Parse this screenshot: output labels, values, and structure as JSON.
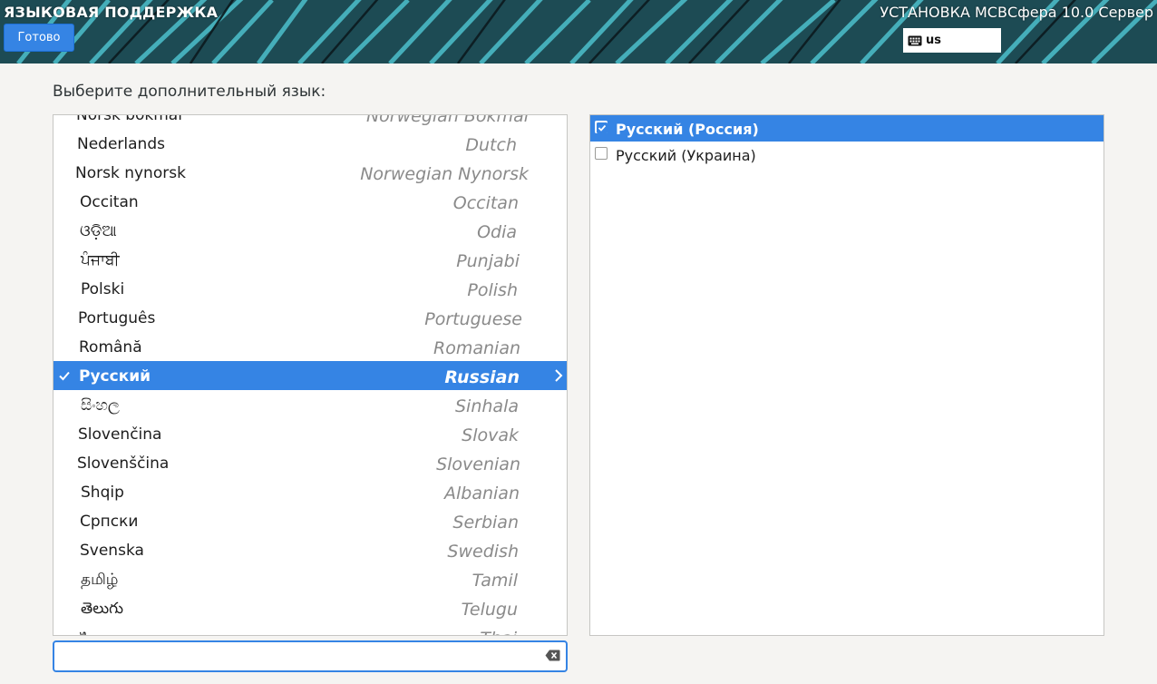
{
  "header": {
    "spoke_title": "ЯЗЫКОВАЯ ПОДДЕРЖКА",
    "done_label": "Готово",
    "product_title": "УСТАНОВКА МСВСфера 10.0 Сервер",
    "keyboard_layout": "us"
  },
  "prompt": "Выберите дополнительный язык:",
  "languages": [
    {
      "native": "Norsk bokmål",
      "english": "Norwegian Bokmål"
    },
    {
      "native": "Nederlands",
      "english": "Dutch"
    },
    {
      "native": "Norsk nynorsk",
      "english": "Norwegian Nynorsk"
    },
    {
      "native": "Occitan",
      "english": "Occitan"
    },
    {
      "native": "ଓଡ଼ିଆ",
      "english": "Odia"
    },
    {
      "native": "ਪੰਜਾਬੀ",
      "english": "Punjabi"
    },
    {
      "native": "Polski",
      "english": "Polish"
    },
    {
      "native": "Português",
      "english": "Portuguese"
    },
    {
      "native": "Română",
      "english": "Romanian"
    },
    {
      "native": "Русский",
      "english": "Russian",
      "selected": true
    },
    {
      "native": "සිංහල",
      "english": "Sinhala"
    },
    {
      "native": "Slovenčina",
      "english": "Slovak"
    },
    {
      "native": "Slovenščina",
      "english": "Slovenian"
    },
    {
      "native": "Shqip",
      "english": "Albanian"
    },
    {
      "native": "Српски",
      "english": "Serbian"
    },
    {
      "native": "Svenska",
      "english": "Swedish"
    },
    {
      "native": "தமிழ்",
      "english": "Tamil"
    },
    {
      "native": "తెలుగు",
      "english": "Telugu"
    },
    {
      "native": "ไทย",
      "english": "Thai"
    }
  ],
  "locales": [
    {
      "label": "Русский (Россия)",
      "checked": true,
      "selected": true
    },
    {
      "label": "Русский (Украина)",
      "checked": false,
      "selected": false
    }
  ],
  "search": {
    "value": "",
    "placeholder": ""
  },
  "icons": {
    "keyboard": "keyboard-icon",
    "check": "checkmark-icon",
    "chevron": "chevron-right-icon",
    "clear": "clear-text-icon"
  },
  "colors": {
    "accent": "#3584e4",
    "header_bg": "#1f4a52",
    "page_bg": "#f5f4f2"
  }
}
